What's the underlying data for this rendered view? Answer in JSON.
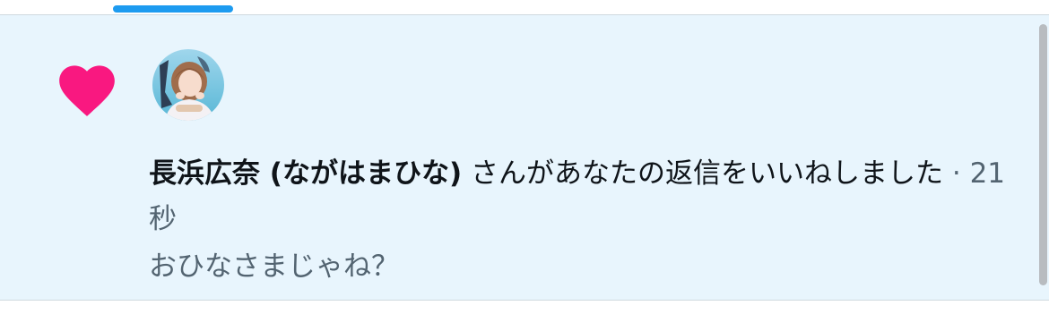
{
  "notification": {
    "user_name": "長浜広奈 (ながはまひな)",
    "action_text": " さんがあなたの返信をいいねしました",
    "separator": " · ",
    "time": "21秒",
    "reply_text": "おひなさまじゃね？"
  },
  "icons": {
    "heart": "heart-icon",
    "avatar": "avatar"
  },
  "colors": {
    "accent": "#1d9bf0",
    "heart": "#f91880",
    "notification_background": "#e8f5fd",
    "primary_text": "#0f1419",
    "secondary_text": "#536471"
  }
}
